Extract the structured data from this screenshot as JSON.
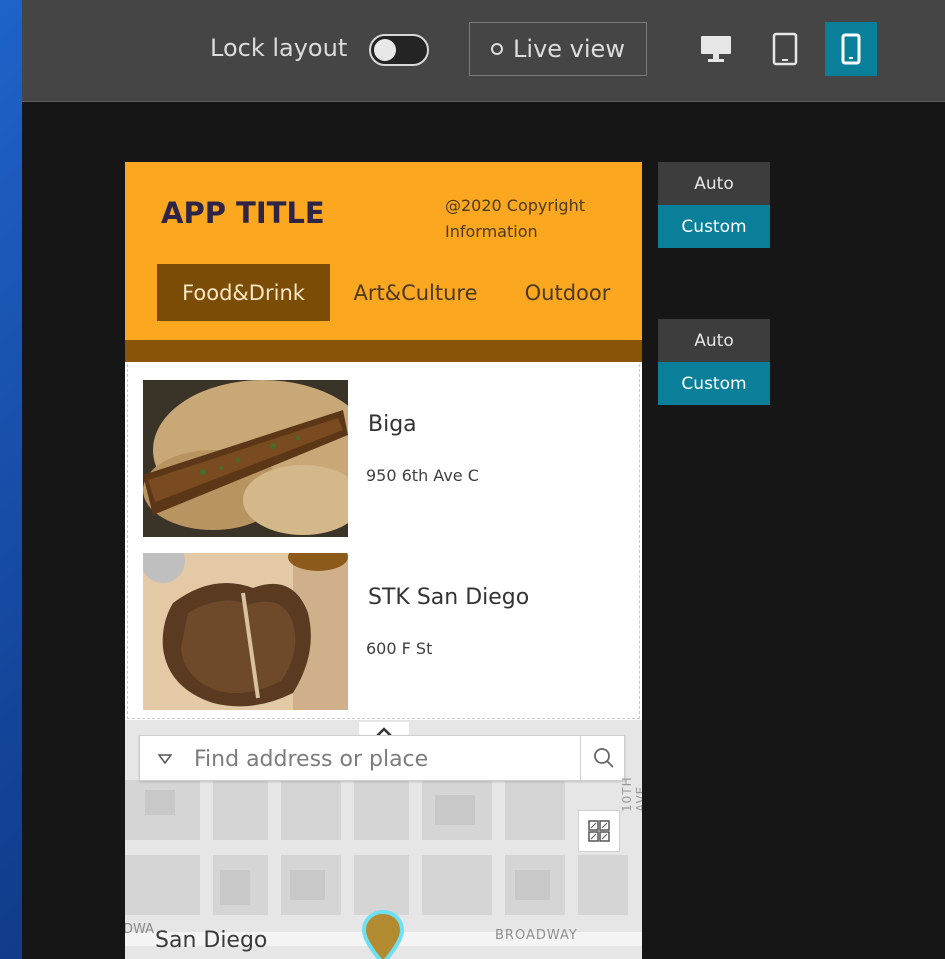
{
  "toolbar": {
    "lock_label": "Lock layout",
    "lock_on": false,
    "live_view_label": "Live view",
    "devices": [
      "desktop-icon",
      "tablet-icon",
      "mobile-icon"
    ],
    "active_device": "mobile",
    "accent": "#0a7f99"
  },
  "app": {
    "title": "APP TITLE",
    "copyright_line1": "@2020 Copyright",
    "copyright_line2": "Information",
    "header_color": "#fba71f",
    "tabs": [
      {
        "label": "Food&Drink",
        "active": true
      },
      {
        "label": "Art&Culture",
        "active": false
      },
      {
        "label": "Outdoor",
        "active": false
      }
    ],
    "items": [
      {
        "name": "Biga",
        "address": "950 6th Ave C",
        "image": "bone-marrow-pasta-photo"
      },
      {
        "name": "STK San Diego",
        "address": "600 F St",
        "image": "t-bone-steak-photo"
      }
    ]
  },
  "map": {
    "search_placeholder": "Find address or place",
    "labels": {
      "city": "San Diego",
      "street_broadway": "BROADWAY",
      "street_10th": "10TH AVE",
      "street_cut": "DWA"
    }
  },
  "size_pickers": [
    {
      "auto_label": "Auto",
      "custom_label": "Custom",
      "selected": "Custom"
    },
    {
      "auto_label": "Auto",
      "custom_label": "Custom",
      "selected": "Custom"
    }
  ]
}
